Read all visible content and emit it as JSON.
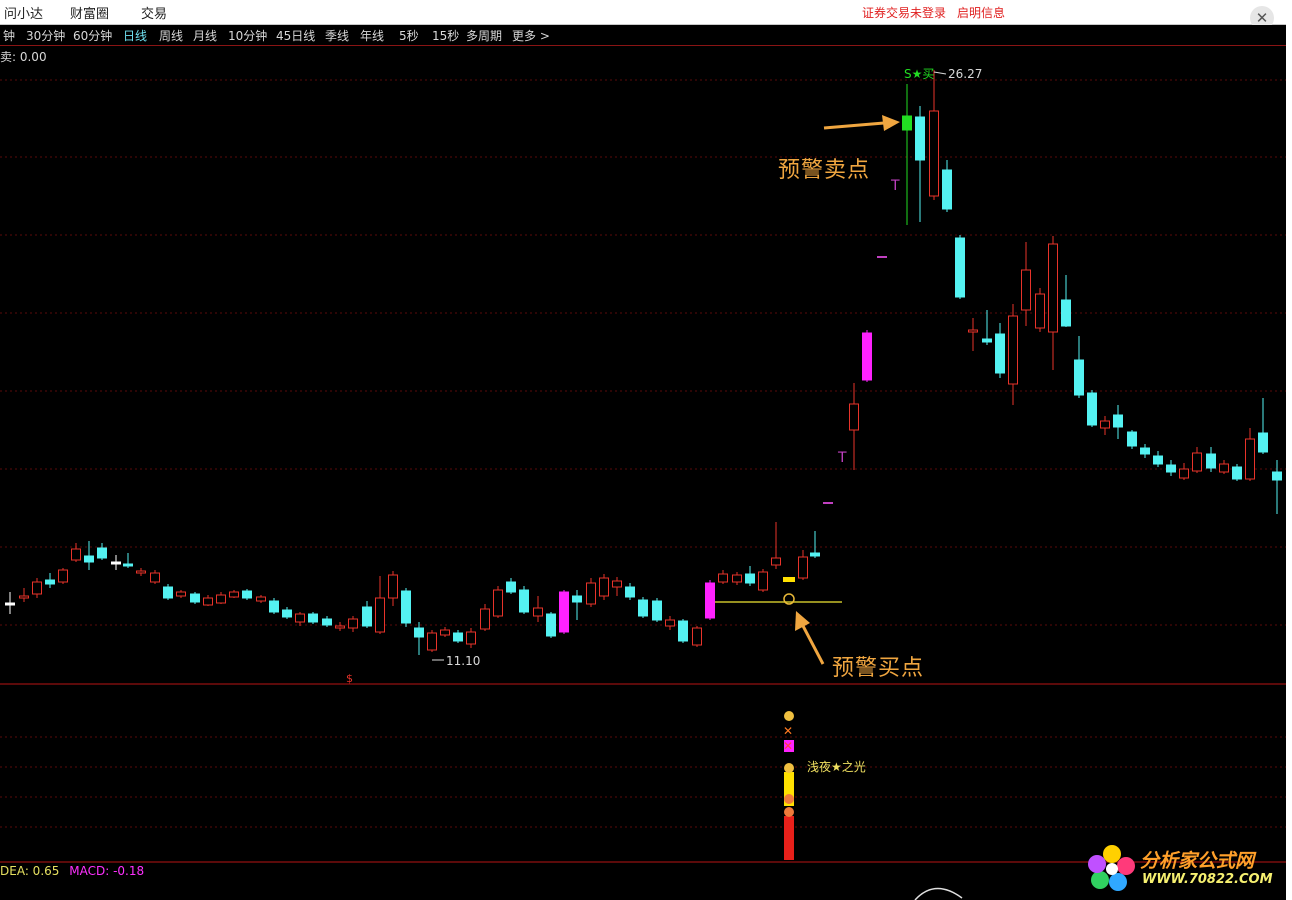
{
  "menubar": {
    "items": [
      "问小达",
      "财富圈",
      "交易"
    ],
    "status_login": "证券交易未登录",
    "status_info": "启明信息"
  },
  "periods": {
    "tabs": [
      "钟",
      "30分钟",
      "60分钟",
      "日线",
      "周线",
      "月线",
      "10分钟",
      "45日线",
      "季线",
      "年线",
      "5秒",
      "15秒",
      "多周期",
      "更多"
    ],
    "active": "日线"
  },
  "main_panel": {
    "readout": "卖: 0.00",
    "high_label": "26.27",
    "low_label": "11.10",
    "sell_signal": "S★买",
    "warn_sell": "预警卖点",
    "warn_buy": "预警买点"
  },
  "lower_panel": {
    "indicator_label": "浅夜★之光"
  },
  "macd_readout": {
    "dea": "DEA: 0.65",
    "macd": "MACD: -0.18"
  },
  "watermark": {
    "title": "分析家公式网",
    "url": "WWW.70822.COM"
  },
  "colors": {
    "up": "#e8332a",
    "down": "#54f2f2",
    "magenta": "#ff22ff",
    "green": "#22dd22",
    "accent_orange": "#f0a640",
    "grid_red": "#b81414"
  }
}
